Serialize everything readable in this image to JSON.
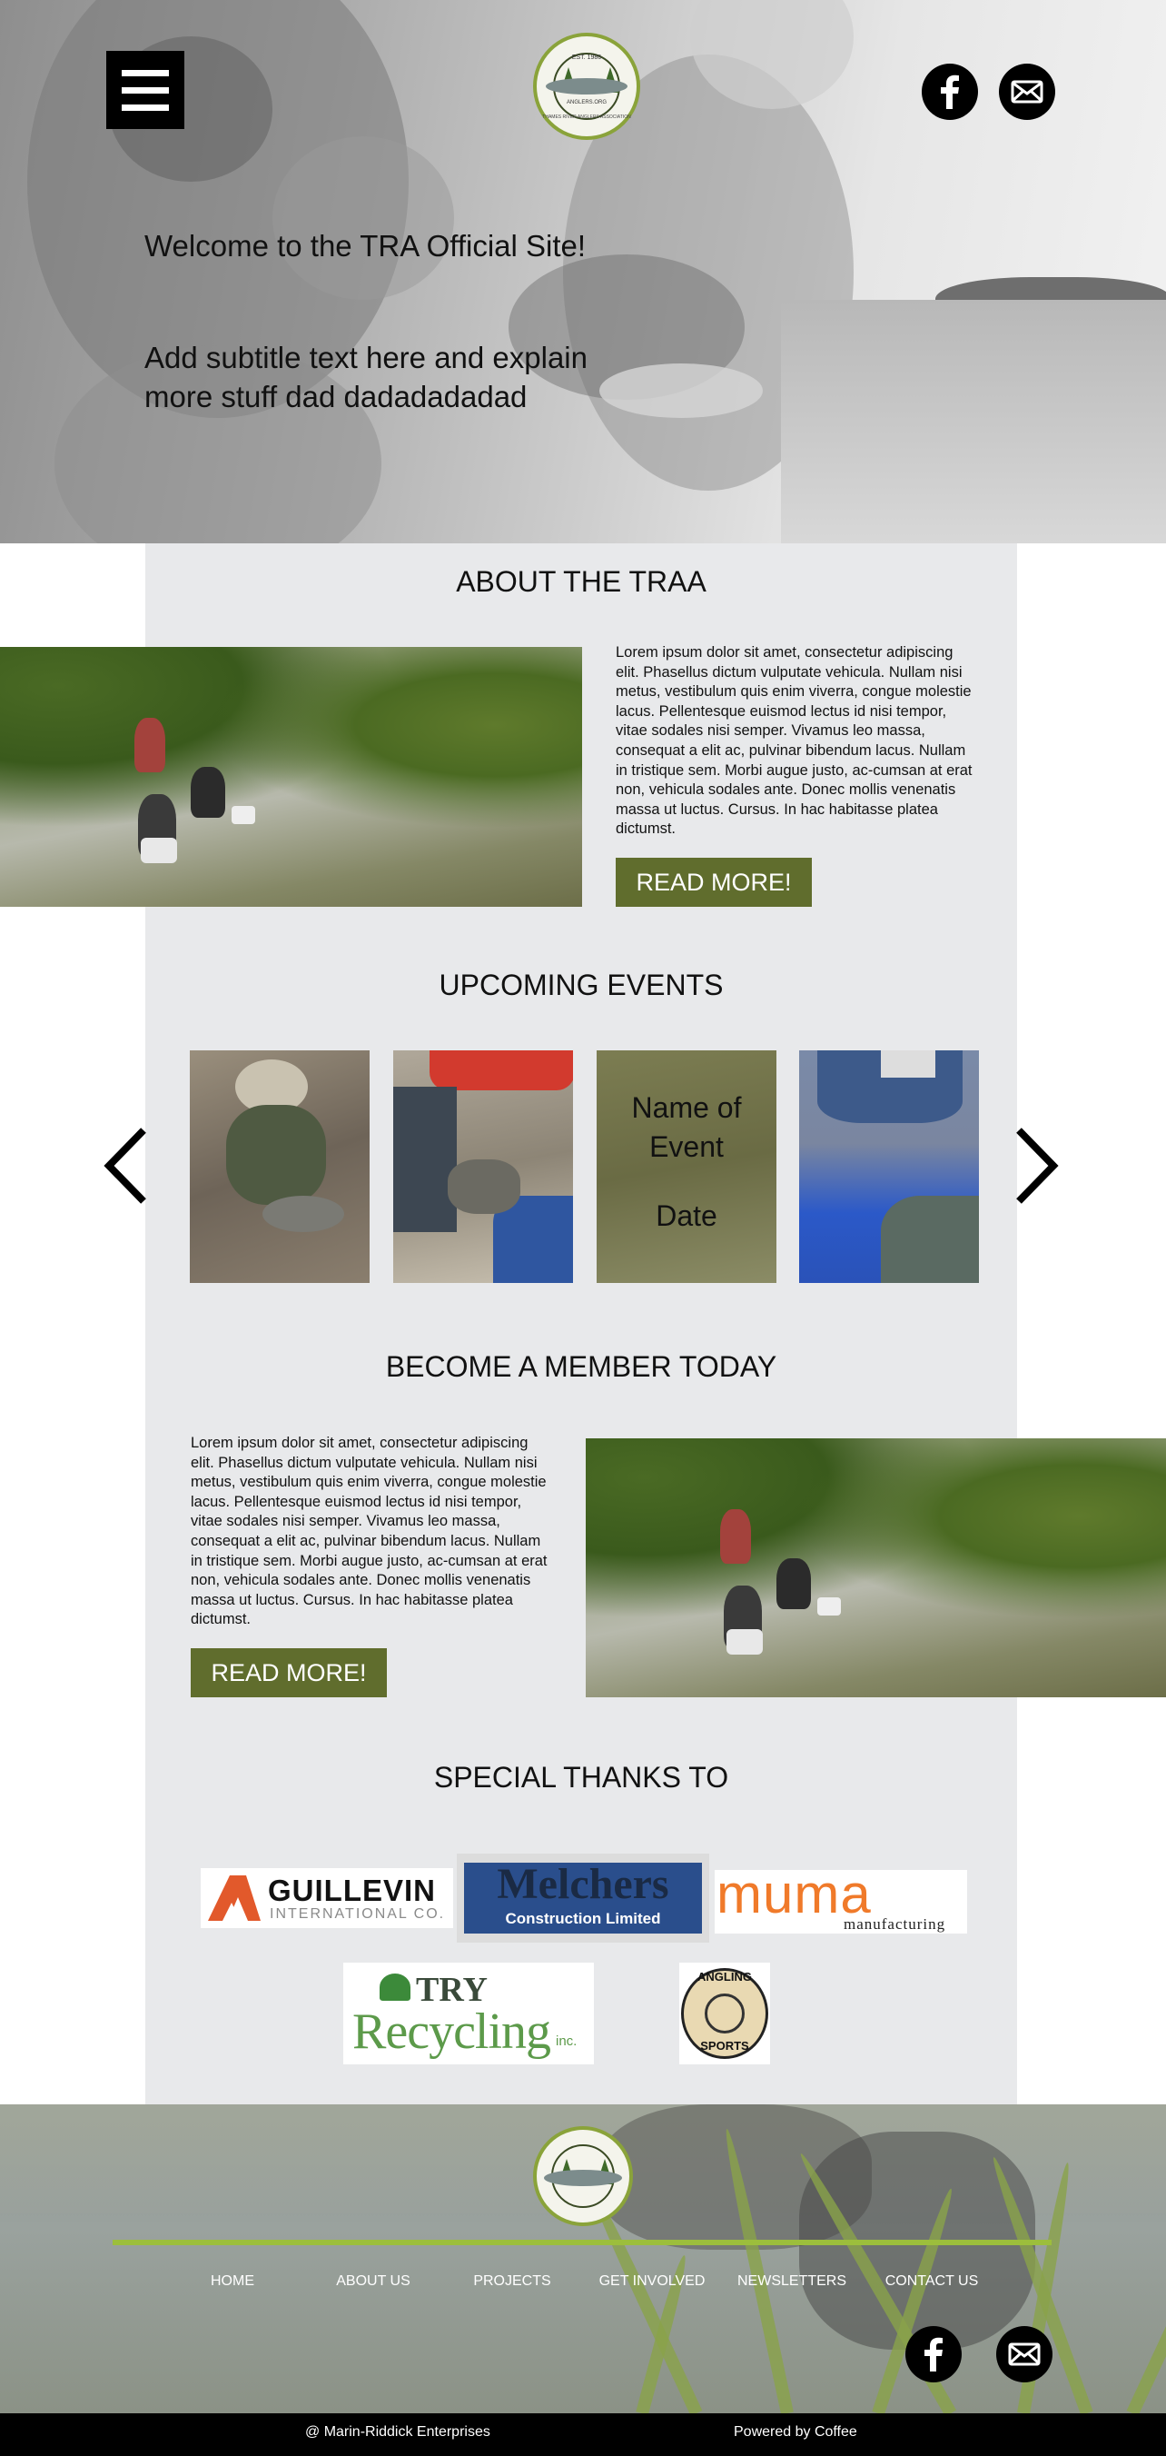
{
  "hero": {
    "title": "Welcome to the TRA Official Site!",
    "subtitle": "Add subtitle text here and explain more stuff dad dadadadadad"
  },
  "logo": {
    "top_text": "EST. 1986",
    "mid_text": "ANGLERS.ORG",
    "bottom_text": "THAMES RIVER ANGLERS ASSOCIATION"
  },
  "icons": {
    "menu": "hamburger-menu-icon",
    "facebook": "facebook-icon",
    "email": "email-icon",
    "prev": "chevron-left-icon",
    "next": "chevron-right-icon"
  },
  "about": {
    "title": "ABOUT THE TRAA",
    "body": "Lorem ipsum dolor sit amet, consectetur adipiscing elit. Phasellus dictum vulputate vehicula. Nullam nisi metus, vestibulum quis enim viverra, congue molestie lacus. Pellentesque euismod lectus id nisi tempor, vitae sodales nisi semper. Vivamus leo massa, consequat a elit ac, pulvinar bibendum lacus. Nullam in tristique sem. Morbi augue justo, ac-cumsan at erat non, vehicula sodales ante. Donec mollis venenatis massa ut luctus. Cursus. In hac habitasse platea dictumst.",
    "button": "READ MORE!"
  },
  "events": {
    "title": "UPCOMING EVENTS",
    "card_name": "Name of Event",
    "card_date": "Date"
  },
  "member": {
    "title": "BECOME A MEMBER TODAY",
    "body": "Lorem ipsum dolor sit amet, consectetur adipiscing elit. Phasellus dictum vulputate vehicula. Nullam nisi metus, vestibulum quis enim viverra, congue molestie lacus. Pellentesque euismod lectus id nisi tempor, vitae sodales nisi semper. Vivamus leo massa, consequat a elit ac, pulvinar bibendum lacus. Nullam in tristique sem. Morbi augue justo, ac-cumsan at erat non, vehicula sodales ante. Donec mollis venenatis massa ut luctus. Cursus. In hac habitasse platea dictumst.",
    "button": "READ MORE!"
  },
  "sponsors": {
    "title": "SPECIAL THANKS TO",
    "guillevin": {
      "name": "GUILLEVIN",
      "sub": "INTERNATIONAL CO."
    },
    "melchers": {
      "name": "Melchers",
      "sub": "Construction Limited"
    },
    "muma": {
      "name": "muma",
      "sub": "manufacturing"
    },
    "try": {
      "name1": "TRY",
      "name2": "Recycling",
      "suffix": "inc."
    },
    "angling": {
      "top": "ANGLING",
      "bottom": "SPORTS"
    }
  },
  "footer": {
    "nav": [
      "HOME",
      "ABOUT US",
      "PROJECTS",
      "GET INVOLVED",
      "NEWSLETTERS",
      "CONTACT US"
    ],
    "left_credit": "@ Marin-Riddick Enterprises",
    "right_credit": "Powered by Coffee"
  },
  "colors": {
    "accent_green": "#606d2d",
    "line_green": "#9cbe3c",
    "panel_gray": "#e8e9eb"
  }
}
